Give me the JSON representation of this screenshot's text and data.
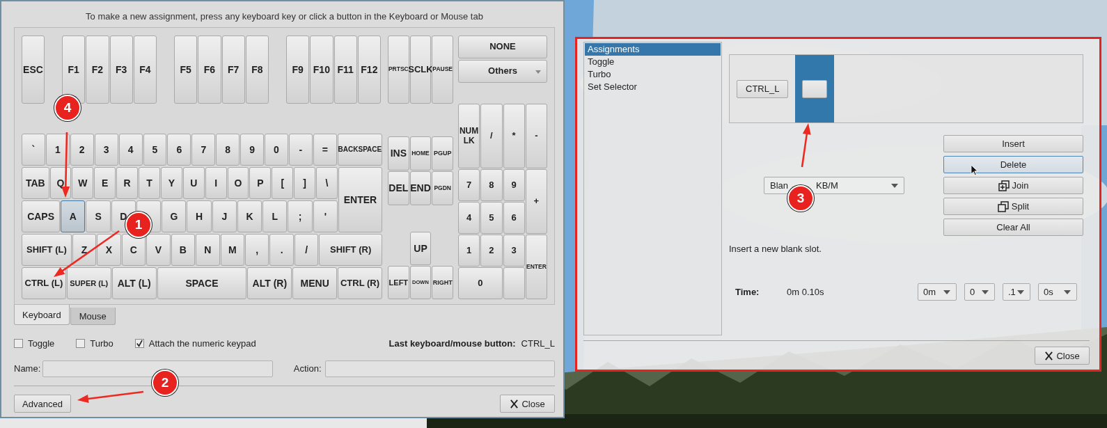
{
  "left_dialog": {
    "instruction": "To make a new assignment, press any keyboard key or click a button in the Keyboard or Mouse tab",
    "keyboard": {
      "function_keys": [
        [
          {
            "label": "ESC",
            "selected": false
          }
        ],
        [
          {
            "label": "F1",
            "selected": false
          },
          {
            "label": "F2",
            "selected": false
          },
          {
            "label": "F3",
            "selected": false
          },
          {
            "label": "F4",
            "selected": false
          }
        ],
        [
          {
            "label": "F5",
            "selected": false
          },
          {
            "label": "F6",
            "selected": false
          },
          {
            "label": "F7",
            "selected": false
          },
          {
            "label": "F8",
            "selected": false
          }
        ],
        [
          {
            "label": "F9",
            "selected": false
          },
          {
            "label": "F10",
            "selected": false
          },
          {
            "label": "F11",
            "selected": false
          },
          {
            "label": "F12",
            "selected": false
          }
        ]
      ],
      "main_rows": [
        [
          {
            "label": "`",
            "selected": false
          },
          {
            "label": "1",
            "selected": false
          },
          {
            "label": "2",
            "selected": false
          },
          {
            "label": "3",
            "selected": false
          },
          {
            "label": "4",
            "selected": false
          },
          {
            "label": "5",
            "selected": false
          },
          {
            "label": "6",
            "selected": false
          },
          {
            "label": "7",
            "selected": false
          },
          {
            "label": "8",
            "selected": false
          },
          {
            "label": "9",
            "selected": false
          },
          {
            "label": "0",
            "selected": false
          },
          {
            "label": "-",
            "selected": false
          },
          {
            "label": "=",
            "selected": false
          },
          {
            "label": "BACKSPACE",
            "selected": false
          }
        ],
        [
          {
            "label": "TAB",
            "selected": false
          },
          {
            "label": "Q",
            "selected": false
          },
          {
            "label": "W",
            "selected": false
          },
          {
            "label": "E",
            "selected": false
          },
          {
            "label": "R",
            "selected": false
          },
          {
            "label": "T",
            "selected": false
          },
          {
            "label": "Y",
            "selected": false
          },
          {
            "label": "U",
            "selected": false
          },
          {
            "label": "I",
            "selected": false
          },
          {
            "label": "O",
            "selected": false
          },
          {
            "label": "P",
            "selected": false
          },
          {
            "label": "[",
            "selected": false
          },
          {
            "label": "]",
            "selected": false
          },
          {
            "label": "\\",
            "selected": false
          }
        ],
        [
          {
            "label": "CAPS",
            "selected": false
          },
          {
            "label": "A",
            "selected": true
          },
          {
            "label": "S",
            "selected": false
          },
          {
            "label": "D",
            "selected": false
          },
          {
            "selected": false
          },
          {
            "label": "G",
            "selected": false
          },
          {
            "label": "H",
            "selected": false
          },
          {
            "label": "J",
            "selected": false
          },
          {
            "label": "K",
            "selected": false
          },
          {
            "label": "L",
            "selected": false
          },
          {
            "label": ";",
            "selected": false
          },
          {
            "label": "'",
            "selected": false
          }
        ],
        [
          {
            "label": "SHIFT (L)",
            "selected": false
          },
          {
            "label": "Z",
            "selected": false
          },
          {
            "label": "X",
            "selected": false
          },
          {
            "label": "C",
            "selected": false
          },
          {
            "label": "V",
            "selected": false
          },
          {
            "label": "B",
            "selected": false
          },
          {
            "label": "N",
            "selected": false
          },
          {
            "label": "M",
            "selected": false
          },
          {
            "label": ",",
            "selected": false
          },
          {
            "label": ".",
            "selected": false
          },
          {
            "label": "/",
            "selected": false
          },
          {
            "label": "SHIFT (R)",
            "selected": false
          }
        ],
        [
          {
            "label": "CTRL (L)",
            "selected": false
          },
          {
            "label": "SUPER (L)",
            "selected": false
          },
          {
            "label": "ALT (L)",
            "selected": false
          },
          {
            "label": "SPACE",
            "selected": false
          },
          {
            "label": "ALT (R)",
            "selected": false
          },
          {
            "label": "MENU",
            "selected": false
          },
          {
            "label": "CTRL (R)",
            "selected": false
          }
        ]
      ],
      "enter_key": {
        "label": "ENTER",
        "selected": false
      },
      "system_keys": [
        {
          "label": "PRTSC",
          "selected": false
        },
        {
          "label": "SCLK",
          "selected": false
        },
        {
          "label": "PAUSE",
          "selected": false
        }
      ],
      "nav_keys": [
        {
          "label": "INS",
          "selected": false
        },
        {
          "label": "HOME",
          "selected": false
        },
        {
          "label": "PGUP",
          "selected": false
        },
        {
          "label": "DEL",
          "selected": false
        },
        {
          "label": "END",
          "selected": false
        },
        {
          "label": "PGDN",
          "selected": false
        },
        {
          "label": "UP",
          "selected": false
        },
        {
          "label": "LEFT",
          "selected": false
        },
        {
          "label": "DOWN",
          "selected": false
        },
        {
          "label": "RIGHT",
          "selected": false
        }
      ],
      "special_buttons": [
        {
          "label": "NONE",
          "kind": "button"
        },
        {
          "label": "Others",
          "kind": "dropdown"
        }
      ],
      "numpad_keys": [
        {
          "label": "NUM LK",
          "selected": false
        },
        {
          "label": "/",
          "selected": false
        },
        {
          "label": "*",
          "selected": false
        },
        {
          "label": "-",
          "selected": false
        },
        {
          "label": "7",
          "selected": false
        },
        {
          "label": "8",
          "selected": false
        },
        {
          "label": "9",
          "selected": false
        },
        {
          "label": "+",
          "selected": false
        },
        {
          "label": "4",
          "selected": false
        },
        {
          "label": "5",
          "selected": false
        },
        {
          "label": "6",
          "selected": false
        },
        {
          "label": "1",
          "selected": false
        },
        {
          "label": "2",
          "selected": false
        },
        {
          "label": "3",
          "selected": false
        },
        {
          "label": "ENTER",
          "selected": false
        },
        {
          "label": "0",
          "selected": false
        },
        {
          "selected": false
        }
      ]
    },
    "tabs": [
      {
        "label": "Keyboard",
        "selected": true
      },
      {
        "label": "Mouse",
        "selected": false
      }
    ],
    "options": [
      {
        "label": "Toggle",
        "checked": false
      },
      {
        "label": "Turbo",
        "checked": false
      },
      {
        "label": "Attach the numeric keypad",
        "checked": true
      }
    ],
    "last_button": {
      "label": "Last keyboard/mouse button:",
      "value": "CTRL_L"
    },
    "fields": [
      {
        "label": "Name:"
      },
      {
        "label": "Action:"
      }
    ],
    "advanced_button": "Advanced",
    "close_button": "Close"
  },
  "right_dialog": {
    "list": [
      {
        "label": "Assignments",
        "selected": true
      },
      {
        "label": "Toggle",
        "selected": false
      },
      {
        "label": "Turbo",
        "selected": false
      },
      {
        "label": "Set Selector",
        "selected": false
      }
    ],
    "sequence": [
      {
        "label": "CTRL_L",
        "selected": false
      },
      {
        "selected": true
      }
    ],
    "slot_type": [
      "Blan",
      "KB/M"
    ],
    "buttons": [
      {
        "label": "Insert",
        "kind": "plain",
        "focused": false
      },
      {
        "label": "Delete",
        "kind": "plain",
        "focused": true
      },
      {
        "label": "Join",
        "kind": "join",
        "focused": false
      },
      {
        "label": "Split",
        "kind": "split",
        "focused": false
      },
      {
        "label": "Clear All",
        "kind": "plain",
        "focused": false
      }
    ],
    "hint": "Insert a new blank slot.",
    "time": {
      "label": "Time:",
      "value": "0m 0.10s",
      "selectors": [
        "0m",
        "0",
        ".1",
        "0s"
      ]
    },
    "close_button": "Close"
  },
  "annotations": [
    {
      "label": "4"
    },
    {
      "label": "1"
    },
    {
      "label": "2"
    },
    {
      "label": "3"
    }
  ]
}
